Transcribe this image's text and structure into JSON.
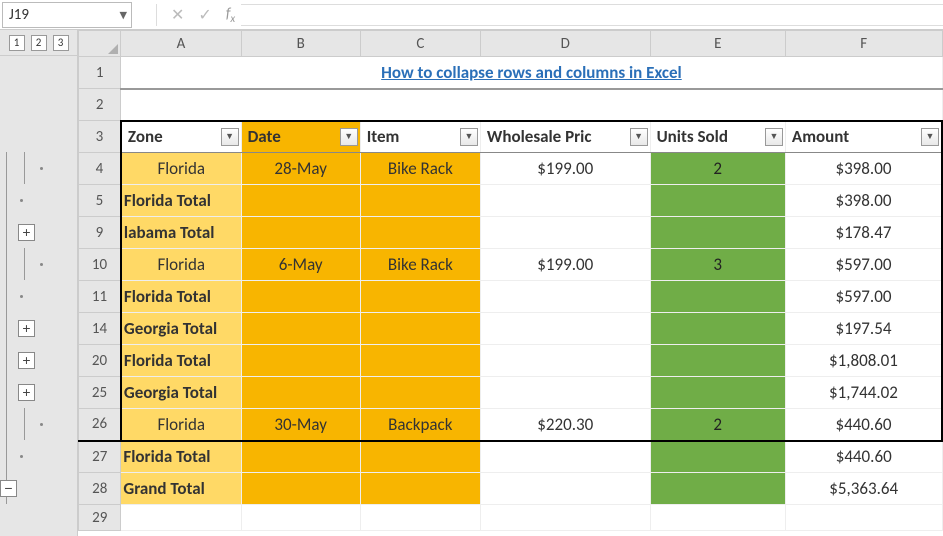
{
  "namebox": {
    "value": "J19"
  },
  "outline_levels": [
    "1",
    "2",
    "3"
  ],
  "title": "How to collapse rows and columns in Excel",
  "columns": [
    "A",
    "B",
    "C",
    "D",
    "E",
    "F"
  ],
  "headers": {
    "zone": "Zone",
    "date": "Date",
    "item": "Item",
    "price": "Wholesale Pric",
    "units": "Units Sold",
    "amount": "Amount"
  },
  "visible_row_numbers": [
    "1",
    "2",
    "3",
    "4",
    "5",
    "9",
    "10",
    "11",
    "14",
    "20",
    "25",
    "26",
    "27",
    "28",
    "29"
  ],
  "rows": [
    {
      "n": "4",
      "zone": "Florida",
      "date": "28-May",
      "item": "Bike Rack",
      "price": "$199.00",
      "units": "2",
      "amount": "$398.00",
      "type": "data"
    },
    {
      "n": "5",
      "zone": "Florida Total",
      "amount": "$398.00",
      "type": "subtotal"
    },
    {
      "n": "9",
      "zone": "Alabama Total",
      "amount": "$178.47",
      "type": "subtotal",
      "trunc": "labama Total"
    },
    {
      "n": "10",
      "zone": "Florida",
      "date": "6-May",
      "item": "Bike Rack",
      "price": "$199.00",
      "units": "3",
      "amount": "$597.00",
      "type": "data"
    },
    {
      "n": "11",
      "zone": "Florida Total",
      "amount": "$597.00",
      "type": "subtotal"
    },
    {
      "n": "14",
      "zone": "Georgia Total",
      "amount": "$197.54",
      "type": "subtotal",
      "trunc": "Georgia Total"
    },
    {
      "n": "20",
      "zone": "Florida Total",
      "amount": "$1,808.01",
      "type": "subtotal"
    },
    {
      "n": "25",
      "zone": "Georgia Total",
      "amount": "$1,744.02",
      "type": "subtotal",
      "trunc": "Georgia Total"
    },
    {
      "n": "26",
      "zone": "Florida",
      "date": "30-May",
      "item": "Backpack",
      "price": "$220.30",
      "units": "2",
      "amount": "$440.60",
      "type": "data",
      "lastdata": true
    },
    {
      "n": "27",
      "zone": "Florida Total",
      "amount": "$440.60",
      "type": "subtotal"
    },
    {
      "n": "28",
      "zone": "Grand Total",
      "amount": "$5,363.64",
      "type": "grand"
    }
  ],
  "outline_buttons": {
    "plus_rows": [
      "9",
      "14",
      "20",
      "25"
    ],
    "minus_rows": [
      "28"
    ]
  }
}
